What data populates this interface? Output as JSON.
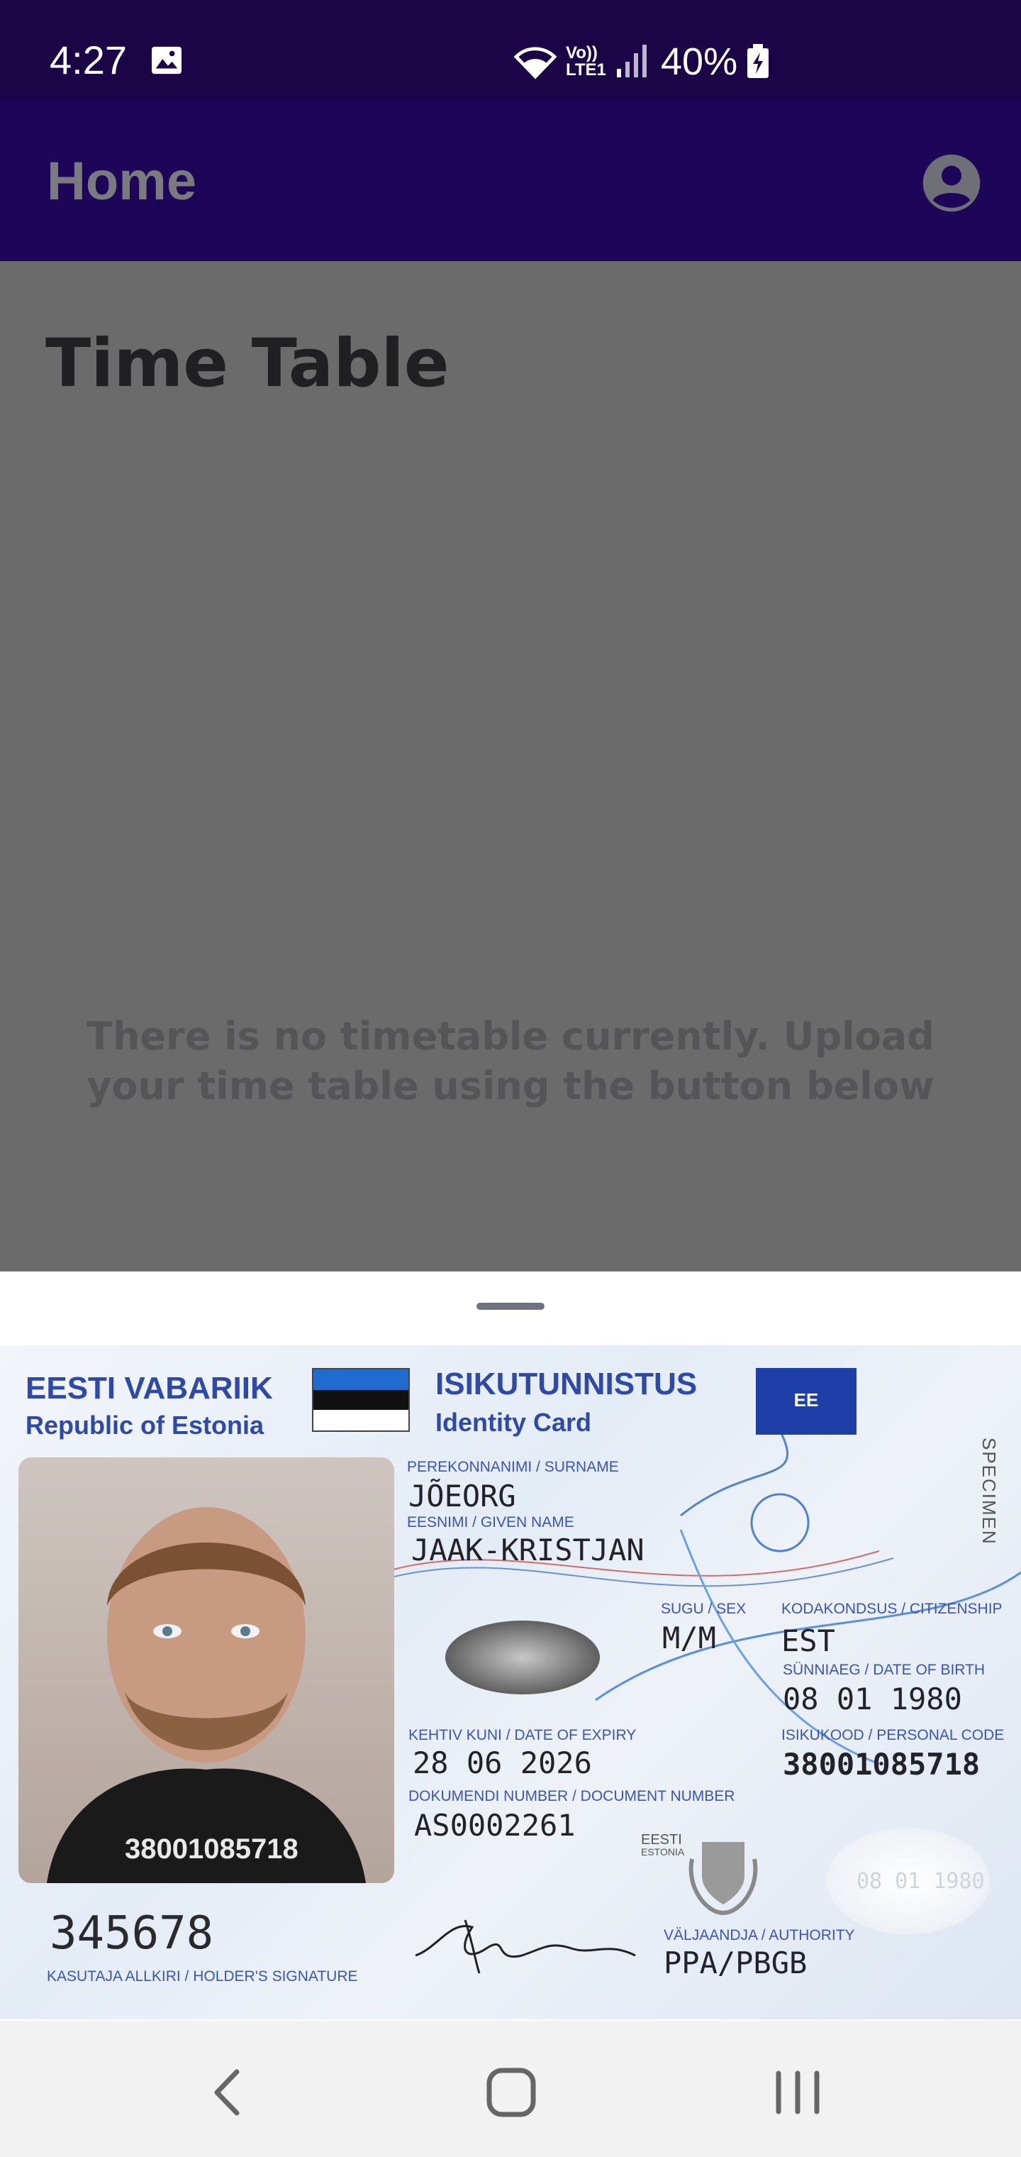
{
  "status_bar": {
    "time": "4:27",
    "network_label": "Vo)) LTE1",
    "battery_percent": "40%",
    "icons": [
      "image-icon",
      "wifi-icon",
      "signal-icon",
      "battery-charging-icon"
    ]
  },
  "app_bar": {
    "title": "Home",
    "account_icon": "account-circle-icon"
  },
  "main": {
    "heading": "Time Table",
    "empty_message": "There is no timetable currently. Upload your time table using the button below"
  },
  "sheet": {
    "id_card": {
      "country_et": "EESTI VABARIIK",
      "country_en": "Republic of Estonia",
      "doc_title_et": "ISIKUTUNNISTUS",
      "doc_title_en": "Identity Card",
      "eu_code": "EE",
      "specimen": "SPECIMEN",
      "surname_label": "PEREKONNANIMI / SURNAME",
      "surname": "JÕEORG",
      "given_name_label": "EESNIMI / GIVEN NAME",
      "given_name": "JAAK-KRISTJAN",
      "sex_label": "SUGU / SEX",
      "sex": "M/M",
      "citizenship_label": "KODAKONDSUS / CITIZENSHIP",
      "citizenship": "EST",
      "dob_label": "SÜNNIAEG / DATE OF BIRTH",
      "dob": "08 01 1980",
      "expiry_label": "KEHTIV KUNI / DATE OF EXPIRY",
      "expiry": "28 06 2026",
      "personal_code_label": "ISIKUKOOD / PERSONAL CODE",
      "personal_code": "38001085718",
      "doc_number_label": "DOKUMENDI NUMBER / DOCUMENT NUMBER",
      "doc_number": "AS0002261",
      "photo_code": "38001085718",
      "card_number": "345678",
      "signature_label": "KASUTAJA ALLKIRI / HOLDER'S SIGNATURE",
      "eesti_small": "EESTI",
      "estonia_small": "ESTONIA",
      "holo_text": "08 01 1980",
      "authority_label": "VÄLJAANDJA / AUTHORITY",
      "authority": "PPA/PBGB"
    }
  },
  "nav_bar": {
    "icons": [
      "back-icon",
      "home-icon",
      "recents-icon"
    ]
  },
  "colors": {
    "status_bar": "#1c0547",
    "app_bar": "#1d0557",
    "scrim": "#6b6b6b",
    "card_blue": "#2f49a8"
  }
}
